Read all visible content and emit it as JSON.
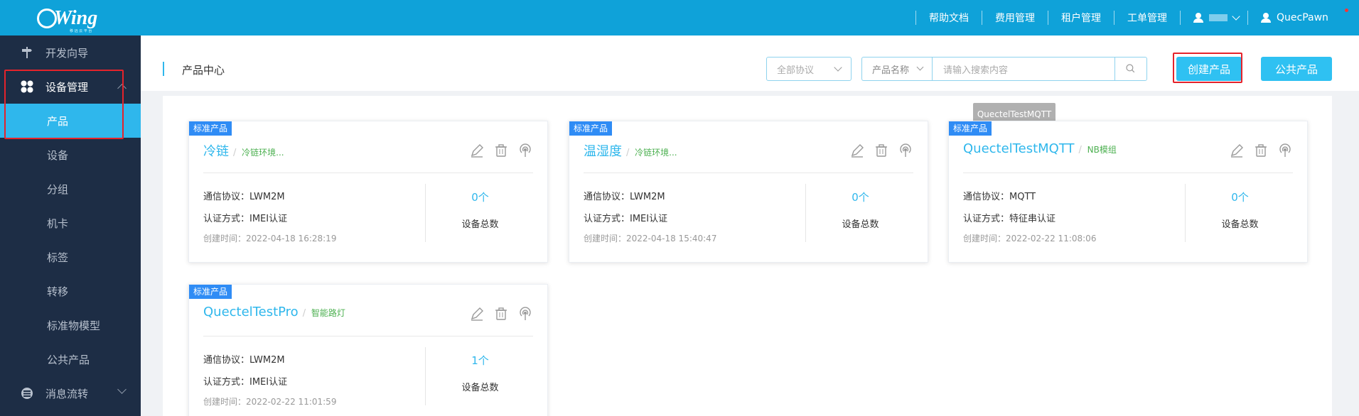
{
  "app": {
    "logo_text": "Wing",
    "logo_sub": "移 远 云 平 台"
  },
  "topnav": {
    "items": [
      "帮助文档",
      "费用管理",
      "租户管理",
      "工单管理"
    ],
    "username": "QuecPawn"
  },
  "sidebar": {
    "items": [
      {
        "label": "开发向导",
        "icon": "signpost-icon"
      },
      {
        "label": "设备管理",
        "icon": "grid-icon"
      },
      {
        "label": "产品"
      },
      {
        "label": "设备"
      },
      {
        "label": "分组"
      },
      {
        "label": "机卡"
      },
      {
        "label": "标签"
      },
      {
        "label": "转移"
      },
      {
        "label": "标准物模型"
      },
      {
        "label": "公共产品"
      },
      {
        "label": "消息流转",
        "icon": "message-flow-icon"
      }
    ]
  },
  "header": {
    "title": "产品中心",
    "protocol_select": "全部协议",
    "search_type": "产品名称",
    "search_placeholder": "请输入搜索内容",
    "create_button": "创建产品",
    "public_button": "公共产品"
  },
  "tooltip": "QuectelTestMQTT",
  "cards": [
    {
      "tag": "标准产品",
      "name": "冷链",
      "category": "冷链环境...",
      "protocol": "通信协议：LWM2M",
      "auth": "认证方式：IMEI认证",
      "created": "创建时间：2022-04-18 16:28:19",
      "count": "0个",
      "count_label": "设备总数"
    },
    {
      "tag": "标准产品",
      "name": "温湿度",
      "category": "冷链环境...",
      "protocol": "通信协议：LWM2M",
      "auth": "认证方式：IMEI认证",
      "created": "创建时间：2022-04-18 15:40:47",
      "count": "0个",
      "count_label": "设备总数"
    },
    {
      "tag": "标准产品",
      "name": "QuectelTestMQTT",
      "category": "NB模组",
      "protocol": "通信协议：MQTT",
      "auth": "认证方式：特征串认证",
      "created": "创建时间：2022-02-22 11:08:06",
      "count": "0个",
      "count_label": "设备总数"
    },
    {
      "tag": "标准产品",
      "name": "QuectelTestPro",
      "category": "智能路灯",
      "protocol": "通信协议：LWM2M",
      "auth": "认证方式：IMEI认证",
      "created": "创建时间：2022-02-22 11:01:59",
      "count": "1个",
      "count_label": "设备总数"
    }
  ],
  "colors": {
    "primary": "#2fb7ec",
    "topbar": "#0fa2d9",
    "sidebar": "#1d2d45",
    "tag": "#2f8cf5",
    "highlight": "#e5232b"
  }
}
